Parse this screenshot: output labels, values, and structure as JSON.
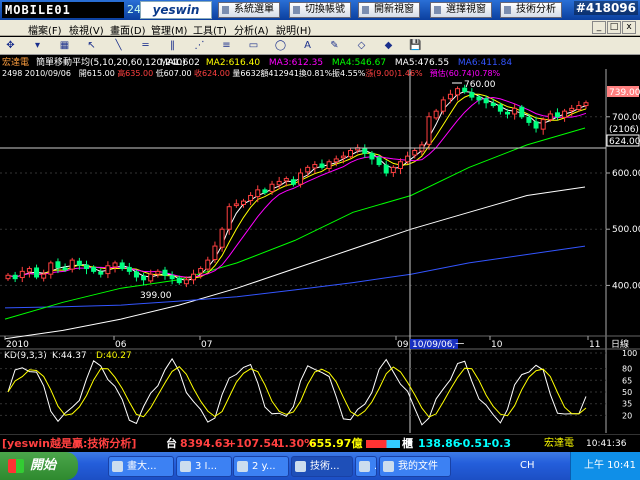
{
  "banner": {
    "logo": "MOBILE01",
    "app_num": "24",
    "brand": "yeswin",
    "buttons": [
      {
        "label": "系統選單"
      },
      {
        "label": "切換帳號"
      },
      {
        "label": "開新視窗"
      },
      {
        "label": "選擇視窗"
      },
      {
        "label": "技術分析"
      }
    ],
    "watermark": "#418096"
  },
  "menu": {
    "items": [
      "檔案(F)",
      "檢視(V)",
      "畫面(D)",
      "管理(M)",
      "工具(T)",
      "分析(A)",
      "說明(H)"
    ],
    "sys_buttons": [
      "_",
      "□",
      "x"
    ]
  },
  "toolbar": {
    "icons": [
      "move-icon",
      "menu-icon",
      "chart-grid-icon",
      "cursor-icon",
      "line-icon",
      "hline-icon",
      "vline-icon",
      "fan-icon",
      "parallel-icon",
      "rect-icon",
      "ellipse-icon",
      "text-icon",
      "pencil-icon",
      "eraser-icon",
      "color-icon",
      "save-icon"
    ],
    "glyphs": [
      "✥",
      "▾",
      "▦",
      "↖",
      "╲",
      "═",
      "‖",
      "⋰",
      "≡",
      "▭",
      "◯",
      "A",
      "✎",
      "◇",
      "◆",
      "💾"
    ]
  },
  "stock": {
    "name": "宏達電",
    "ma_title": "簡單移動平均(5,10,20,60,120,240)",
    "mas": [
      {
        "label": "MA1:602",
        "color": "#ffffff"
      },
      {
        "label": "MA2:616.40",
        "color": "#ffff00"
      },
      {
        "label": "MA3:612.35",
        "color": "#ff00ff"
      },
      {
        "label": "MA4:546.67",
        "color": "#00ff00"
      },
      {
        "label": "MA5:476.55",
        "color": "#ffffff"
      },
      {
        "label": "MA6:411.84",
        "color": "#3355ff"
      }
    ],
    "code": "2498",
    "date": "2010/09/06",
    "open": "開615.00",
    "high": "高635.00",
    "low": "低607.00",
    "close": "收624.00",
    "volume": "量6632",
    "amount": "額412941",
    "turnover": "換0.81%",
    "amplitude": "振4.55%",
    "change": "漲(9.00)1.46%",
    "trend": "預估(60.74)0.78%"
  },
  "chart_data": {
    "type": "candlestick",
    "price_axis": {
      "ticks": [
        400,
        500,
        600,
        700
      ],
      "ylim": [
        310,
        785
      ]
    },
    "labels": {
      "high_label": "760.00",
      "low_label": "399.00",
      "last_price": "739.00",
      "cursor_value": "(2106)",
      "cursor_price": "624.00"
    },
    "x_ticks": [
      "2010",
      "06",
      "07",
      "09",
      "10",
      "11"
    ],
    "cursor_date": "10/09/06,一",
    "date_label": "日線",
    "kd": {
      "title": "KD(9,3,3)",
      "k": "K:44.37",
      "d": "D:40.27",
      "ticks": [
        20,
        35,
        50,
        65,
        80,
        100
      ]
    },
    "ma_curves": [
      {
        "name": "MA5",
        "color": "#ffffff",
        "values": [
          305,
          320,
          340,
          365,
          395,
          430,
          465,
          500,
          530,
          560,
          575
        ]
      },
      {
        "name": "MA6",
        "color": "#3355ff",
        "values": [
          360,
          362,
          365,
          372,
          380,
          392,
          405,
          420,
          440,
          455,
          470
        ]
      },
      {
        "name": "MA4",
        "color": "#00ff00",
        "values": [
          340,
          370,
          395,
          410,
          440,
          480,
          530,
          560,
          610,
          650,
          680
        ]
      }
    ],
    "candles": [
      418,
      412,
      425,
      430,
      415,
      420,
      440,
      432,
      428,
      445,
      436,
      430,
      425,
      420,
      435,
      440,
      430,
      425,
      415,
      410,
      420,
      425,
      418,
      412,
      405,
      410,
      420,
      430,
      445,
      470,
      500,
      540,
      545,
      550,
      560,
      570,
      565,
      580,
      585,
      590,
      580,
      600,
      610,
      615,
      610,
      620,
      625,
      630,
      640,
      645,
      635,
      625,
      615,
      600,
      610,
      620,
      630,
      640,
      650,
      700,
      710,
      730,
      740,
      750,
      745,
      735,
      730,
      725,
      720,
      710,
      705,
      715,
      700,
      690,
      680,
      695,
      705,
      700,
      710,
      715,
      720,
      725
    ]
  },
  "ticker": {
    "slogan": "[yeswin越是贏:技術分析]",
    "index_label": "台",
    "index": "8394.63",
    "index_change": "+107.54",
    "index_pct": "1.30%",
    "index_vol": "655.97億",
    "otc_label": "櫃",
    "otc": "138.86",
    "otc_change": "-0.51",
    "otc_pct": "-0.3",
    "stock": "宏達電",
    "time": "10:41:36"
  },
  "taskbar": {
    "start": "開始",
    "tasks": [
      "畫大...",
      "3 I...",
      "2 y...",
      "技術...",
      "...",
      "我的文件"
    ],
    "lang": "CH",
    "tray_time": "上午 10:41"
  }
}
